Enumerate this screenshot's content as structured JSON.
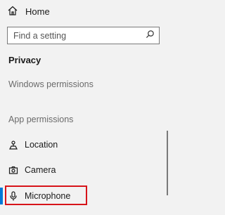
{
  "nav": {
    "home_label": "Home",
    "home_icon": "home-icon"
  },
  "search": {
    "placeholder": "Find a setting",
    "icon": "search-icon"
  },
  "section": {
    "title": "Privacy"
  },
  "groups": {
    "windows_permissions": "Windows permissions",
    "app_permissions": "App permissions"
  },
  "items": [
    {
      "label": "Location",
      "icon": "location-icon"
    },
    {
      "label": "Camera",
      "icon": "camera-icon"
    },
    {
      "label": "Microphone",
      "icon": "microphone-icon",
      "selected": true
    }
  ],
  "colors": {
    "background": "#f2f2f2",
    "accent": "#0078d7",
    "highlight": "#d7141a",
    "group_text": "#6b6b6b"
  }
}
